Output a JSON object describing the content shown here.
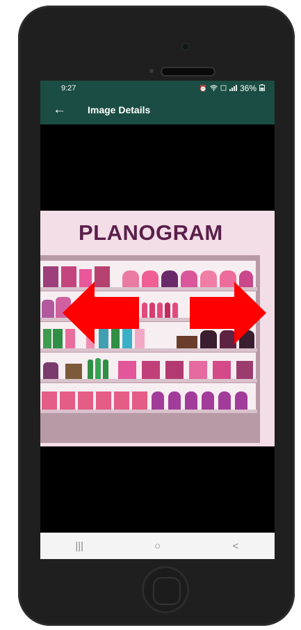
{
  "status_bar": {
    "time": "9:27",
    "battery": "36%",
    "icons": [
      "alarm-icon",
      "wifi-icon",
      "volte-icon",
      "signal-icon",
      "battery-icon"
    ]
  },
  "app_bar": {
    "title": "Image Details",
    "back_icon": "arrow-left-icon"
  },
  "image": {
    "heading": "PLANOGRAM"
  },
  "nav_bar": {
    "recents_label": "|||",
    "home_label": "○",
    "back_label": "<"
  },
  "colors": {
    "app_bar": "#1b4d44",
    "arrow": "#ff0000",
    "planogram_bg": "#f3dde6",
    "heading": "#5a1f4a"
  }
}
